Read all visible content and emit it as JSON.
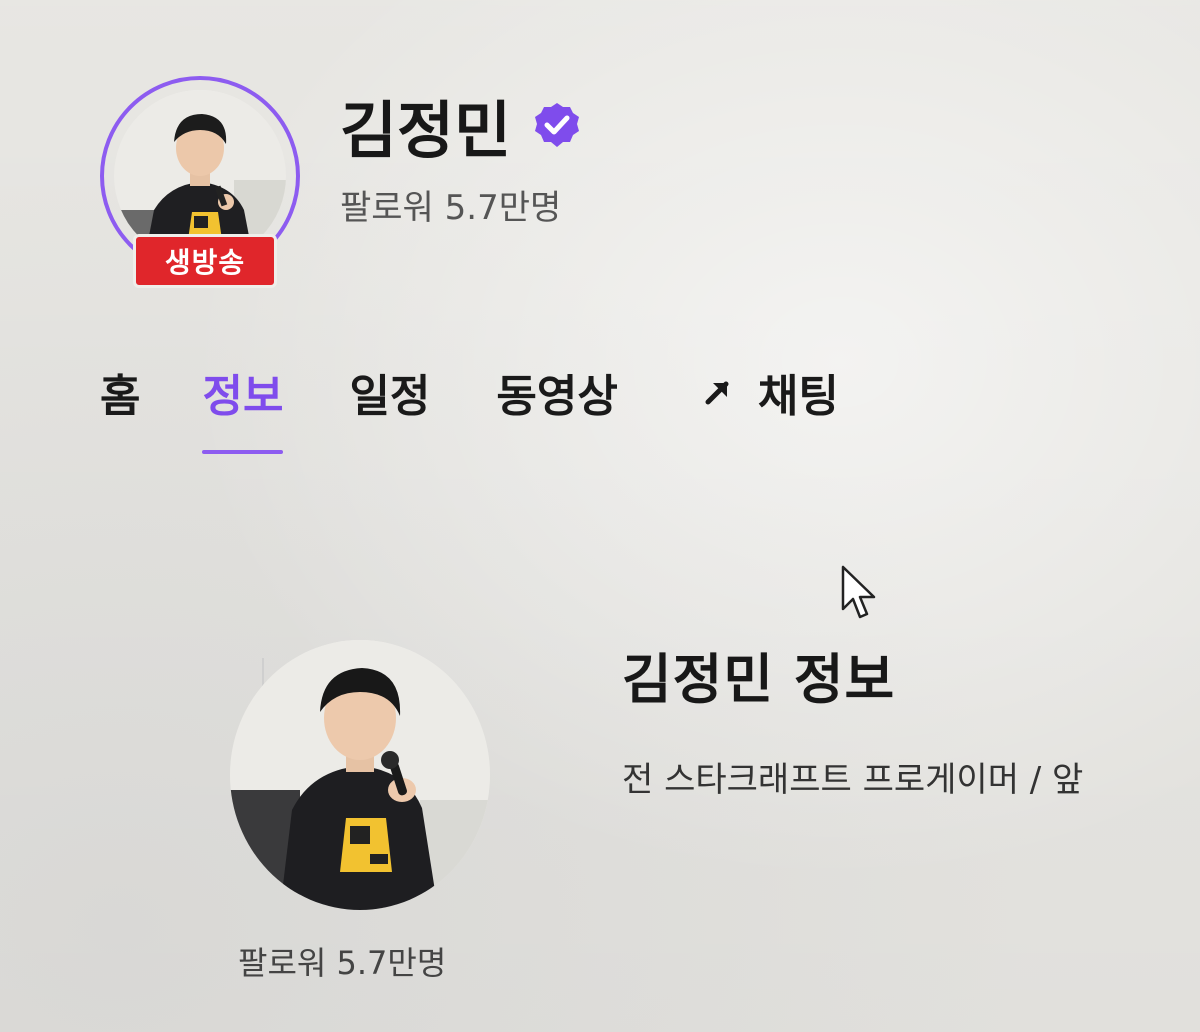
{
  "header": {
    "live_badge": "생방송",
    "channel_name": "김정민",
    "followers": "팔로워 5.7만명"
  },
  "tabs": [
    {
      "label": "홈",
      "active": false
    },
    {
      "label": "정보",
      "active": true
    },
    {
      "label": "일정",
      "active": false
    },
    {
      "label": "동영상",
      "active": false
    },
    {
      "label": "채팅",
      "active": false,
      "icon": "external-arrow-icon"
    }
  ],
  "info": {
    "title": "김정민 정보",
    "description": "전 스타크래프트 프로게이머 / 앞",
    "followers": "팔로워 5.7만명"
  },
  "colors": {
    "accent": "#8d5cf0",
    "live_red": "#e0262b",
    "background": "#efeeea"
  }
}
